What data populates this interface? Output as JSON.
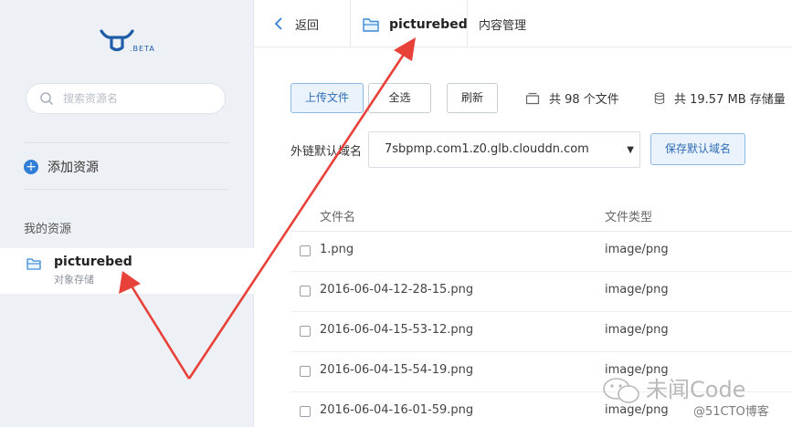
{
  "logo": {
    "badge": ".BETA"
  },
  "sidebar": {
    "search_placeholder": "搜索资源名",
    "add_resource": "添加资源",
    "my_resources_label": "我的资源",
    "bucket": {
      "name": "picturebed",
      "type": "对象存储"
    }
  },
  "topbar": {
    "back": "返回",
    "bucket_name": "picturebed",
    "tab": "内容管理"
  },
  "toolbar": {
    "upload": "上传文件",
    "select_all": "全选",
    "refresh": "刷新",
    "file_count": "共 98 个文件",
    "storage": "共 19.57 MB 存储量"
  },
  "domain": {
    "label": "外链默认域名",
    "value": "7sbpmp.com1.z0.glb.clouddn.com",
    "save": "保存默认域名"
  },
  "table": {
    "headers": {
      "name": "文件名",
      "type": "文件类型"
    },
    "rows": [
      {
        "name": "1.png",
        "type": "image/png"
      },
      {
        "name": "2016-06-04-12-28-15.png",
        "type": "image/png"
      },
      {
        "name": "2016-06-04-15-53-12.png",
        "type": "image/png"
      },
      {
        "name": "2016-06-04-15-54-19.png",
        "type": "image/png"
      },
      {
        "name": "2016-06-04-16-01-59.png",
        "type": "image/png"
      }
    ]
  },
  "watermark": {
    "title": "未闻Code",
    "sub": "@51CTO博客"
  },
  "colors": {
    "accent": "#2f7fd8",
    "arrow": "#e8413a",
    "sidebar_bg": "#edf0f5"
  }
}
